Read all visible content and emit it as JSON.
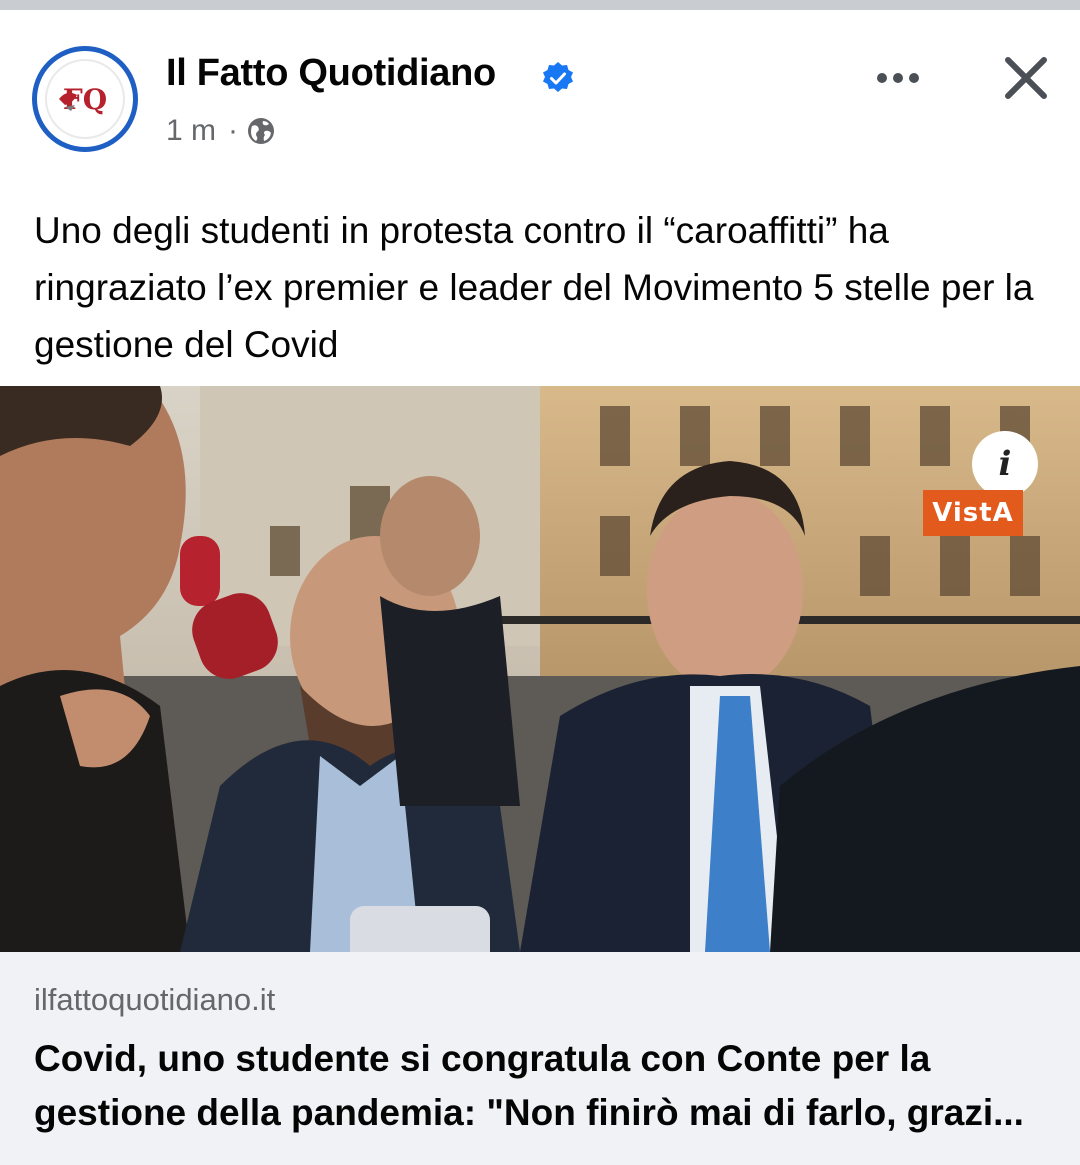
{
  "post": {
    "page_name": "Il Fatto Quotidiano",
    "timestamp": "1 m",
    "separator": "·",
    "audience_icon": "globe-icon",
    "verified_icon": "verified-badge-icon",
    "more_icon": "more-options-icon",
    "close_icon": "close-icon",
    "text": "Uno degli studenti in protesta contro il “caroaffitti” ha ringraziato l’ex premier e leader del Movimento 5 stelle per la gestione del Covid"
  },
  "media": {
    "info_label": "i",
    "watermark": "VistA"
  },
  "link_preview": {
    "domain": "ilfattoquotidiano.it",
    "title": "Covid, uno studente si congratula con Conte per la gestione della pandemia: \"Non finirò mai di farlo, grazi..."
  },
  "colors": {
    "verified_blue": "#1877f2",
    "avatar_ring": "#1f5fc4",
    "secondary_text": "#65676b",
    "link_bg": "#f0f2f5",
    "watermark_orange": "#e25a1c"
  }
}
